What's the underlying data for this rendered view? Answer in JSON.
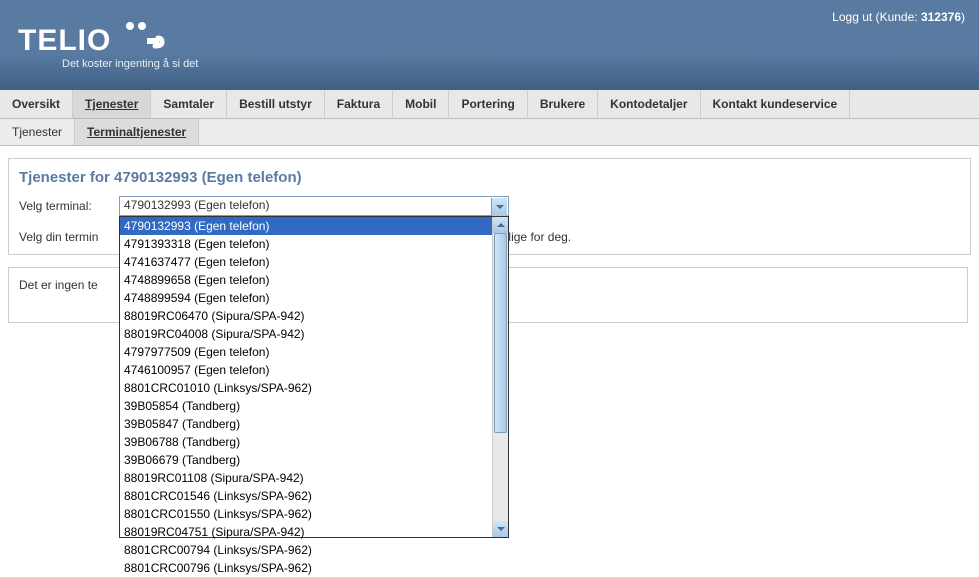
{
  "header": {
    "logo_text": "TELIO",
    "tagline": "Det koster ingenting å si det",
    "logout_label": "Logg ut",
    "customer_label": "Kunde:",
    "customer_id": "312376"
  },
  "nav_main": [
    {
      "label": "Oversikt",
      "active": false
    },
    {
      "label": "Tjenester",
      "active": true
    },
    {
      "label": "Samtaler",
      "active": false
    },
    {
      "label": "Bestill utstyr",
      "active": false
    },
    {
      "label": "Faktura",
      "active": false
    },
    {
      "label": "Mobil",
      "active": false
    },
    {
      "label": "Portering",
      "active": false
    },
    {
      "label": "Brukere",
      "active": false
    },
    {
      "label": "Kontodetaljer",
      "active": false
    },
    {
      "label": "Kontakt kundeservice",
      "active": false
    }
  ],
  "nav_sub": [
    {
      "label": "Tjenester",
      "active": false
    },
    {
      "label": "Terminaltjenester",
      "active": true
    }
  ],
  "panel": {
    "title": "Tjenester for 4790132993 (Egen telefon)",
    "select_label": "Velg terminal:",
    "selected_value": "4790132993 (Egen telefon)",
    "hint_before": "Velg din termin",
    "hint_after": "gelige for deg.",
    "options": [
      "4790132993 (Egen telefon)",
      "4791393318 (Egen telefon)",
      "4741637477 (Egen telefon)",
      "4748899658 (Egen telefon)",
      "4748899594 (Egen telefon)",
      "88019RC06470 (Sipura/SPA-942)",
      "88019RC04008 (Sipura/SPA-942)",
      "4797977509 (Egen telefon)",
      "4746100957 (Egen telefon)",
      "8801CRC01010 (Linksys/SPA-962)",
      "39B05854 (Tandberg)",
      "39B05847 (Tandberg)",
      "39B06788 (Tandberg)",
      "39B06679 (Tandberg)",
      "88019RC01108 (Sipura/SPA-942)",
      "8801CRC01546 (Linksys/SPA-962)",
      "8801CRC01550 (Linksys/SPA-962)",
      "88019RC04751 (Sipura/SPA-942)",
      "8801CRC00794 (Linksys/SPA-962)",
      "8801CRC00796 (Linksys/SPA-962)"
    ]
  },
  "panel2": {
    "text": "Det er ingen te"
  }
}
